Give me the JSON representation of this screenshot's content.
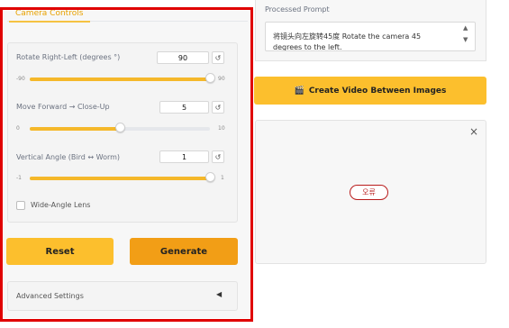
{
  "tab": {
    "label": "Camera Controls"
  },
  "rotate": {
    "label": "Rotate Right-Left (degrees °)",
    "value": "90",
    "min": "-90",
    "max": "90",
    "fraction": 1.0
  },
  "forward": {
    "label": "Move Forward → Close-Up",
    "value": "5",
    "min": "0",
    "max": "10",
    "fraction": 0.5
  },
  "vertical": {
    "label": "Vertical Angle (Bird ↔ Worm)",
    "value": "1",
    "min": "-1",
    "max": "1",
    "fraction": 1.0
  },
  "reset_icon": "↺",
  "wide_angle": {
    "label": "Wide-Angle Lens",
    "checked": false
  },
  "buttons": {
    "reset": "Reset",
    "generate": "Generate"
  },
  "advanced": {
    "label": "Advanced Settings",
    "caret": "◀"
  },
  "prompt": {
    "label": "Processed Prompt",
    "text": "将镜头向左旋转45度 Rotate the camera 45 degrees to the left."
  },
  "video_button": {
    "icon": "🎬",
    "label": "Create Video Between Images"
  },
  "output": {
    "close": "×",
    "error": "오류"
  },
  "icons": [
    "rotate-ccw-icon",
    "close-icon",
    "caret-left-icon",
    "clapper-icon",
    "scroll-up-icon",
    "scroll-down-icon"
  ],
  "colors": {
    "accent": "#f5b82a",
    "generate": "#f29e16",
    "frame": "#e00000",
    "error": "#b91c1c"
  }
}
